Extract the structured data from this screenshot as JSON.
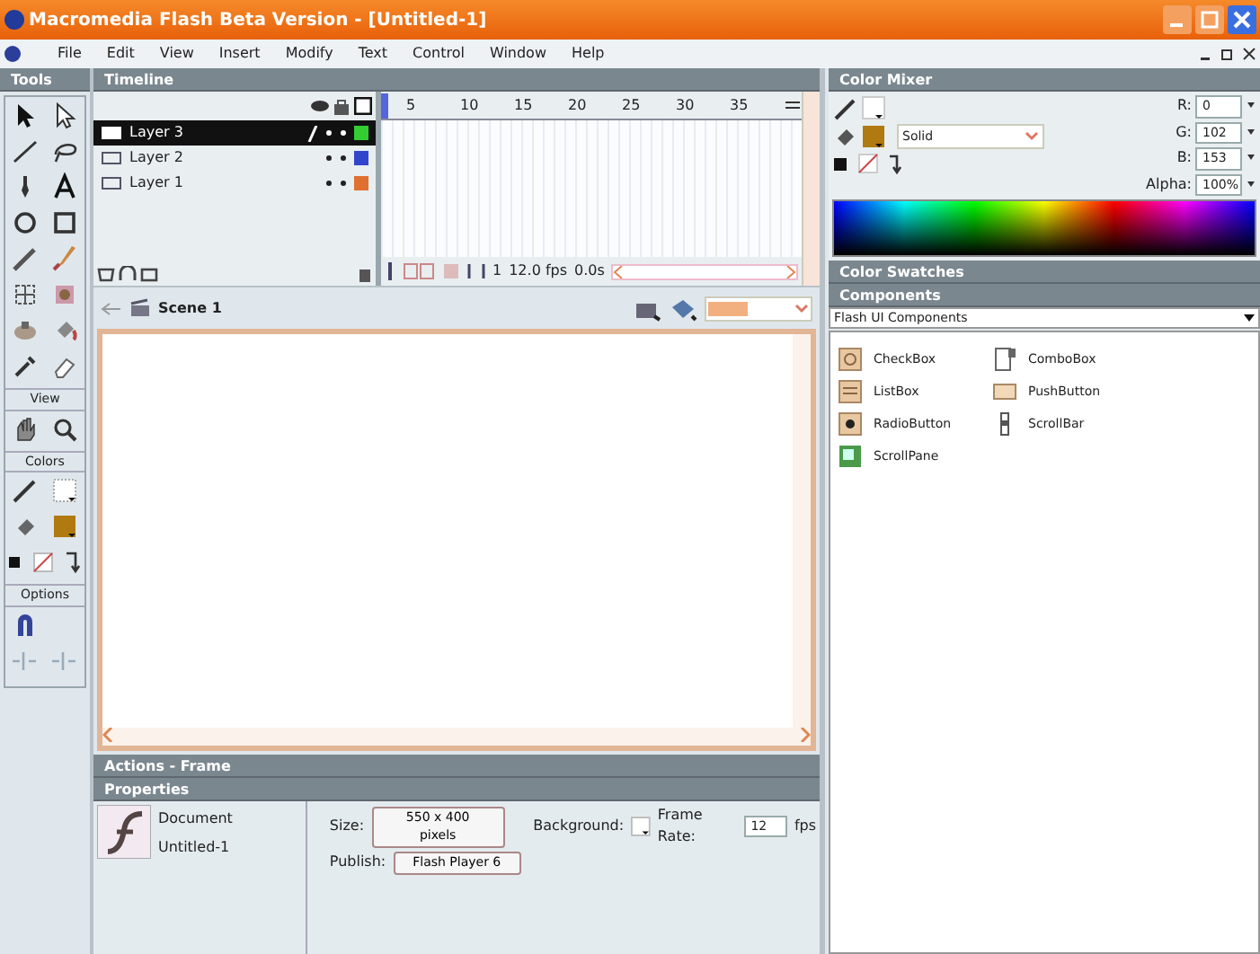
{
  "window": {
    "title": "Macromedia Flash Beta Version - [Untitled-1]"
  },
  "menu": [
    "File",
    "Edit",
    "View",
    "Insert",
    "Modify",
    "Text",
    "Control",
    "Window",
    "Help"
  ],
  "tools": {
    "title": "Tools",
    "sections": [
      "View",
      "Colors",
      "Options"
    ]
  },
  "timeline": {
    "title": "Timeline",
    "frame_numbers": [
      "5",
      "10",
      "15",
      "20",
      "25",
      "30",
      "35"
    ],
    "layers": [
      {
        "name": "Layer 3",
        "selected": true,
        "color": "#33cc33"
      },
      {
        "name": "Layer 2",
        "selected": false,
        "color": "#3344cc"
      },
      {
        "name": "Layer 1",
        "selected": false,
        "color": "#e07030"
      }
    ],
    "current_frame": "1",
    "frame_rate": "12.0 fps",
    "elapsed": "0.0s"
  },
  "scene": {
    "name": "Scene 1"
  },
  "color_mixer": {
    "title": "Color Mixer",
    "fill_style": "Solid",
    "fields": [
      {
        "label": "R:",
        "value": "0"
      },
      {
        "label": "G:",
        "value": "102"
      },
      {
        "label": "B:",
        "value": "153"
      },
      {
        "label": "Alpha:",
        "value": "100%"
      }
    ]
  },
  "color_swatches": {
    "title": "Color Swatches"
  },
  "components": {
    "title": "Components",
    "set": "Flash UI Components",
    "items": [
      "CheckBox",
      "ComboBox",
      "ListBox",
      "PushButton",
      "RadioButton",
      "ScrollBar",
      "ScrollPane"
    ]
  },
  "actions": {
    "title": "Actions - Frame"
  },
  "properties": {
    "title": "Properties",
    "type": "Document",
    "name": "Untitled-1",
    "size_label": "Size:",
    "size": "550 x 400 pixels",
    "background_label": "Background:",
    "frame_rate_label": "Frame Rate:",
    "frame_rate": "12",
    "fps": "fps",
    "publish_label": "Publish:",
    "publish": "Flash Player 6"
  }
}
